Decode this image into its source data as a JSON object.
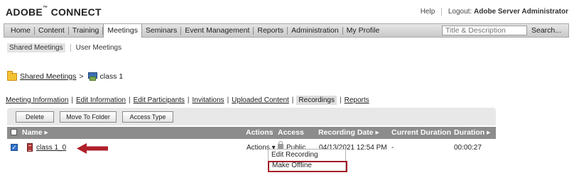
{
  "header": {
    "brand": "ADOBE",
    "brand_rest": " CONNECT",
    "tm": "™",
    "help": "Help",
    "logout": "Logout:",
    "user": "Adobe Server Administrator"
  },
  "nav": {
    "items": [
      "Home",
      "Content",
      "Training",
      "Meetings",
      "Seminars",
      "Event Management",
      "Reports",
      "Administration",
      "My Profile"
    ],
    "active_index": 3,
    "search_placeholder": "Title & Description",
    "search_button": "Search..."
  },
  "subnav": {
    "items": [
      "Shared Meetings",
      "User Meetings"
    ]
  },
  "breadcrumb": {
    "parent": "Shared Meetings",
    "separator": ">",
    "current": "class 1"
  },
  "tabs": {
    "items": [
      "Meeting Information",
      "Edit Information",
      "Edit Participants",
      "Invitations",
      "Uploaded Content",
      "Recordings",
      "Reports"
    ],
    "active_index": 5,
    "separator": "|"
  },
  "toolbar": {
    "delete": "Delete",
    "move": "Move To Folder",
    "access": "Access Type"
  },
  "table": {
    "columns": {
      "name": "Name ▸",
      "actions": "Actions",
      "access": "Access",
      "date": "Recording Date ▸",
      "current": "Current Duration",
      "duration": "Duration ▸"
    },
    "rows": [
      {
        "checked": true,
        "name": "class 1_0",
        "actions": "Actions ▾",
        "access": "Public",
        "date": "04/13/2021 12:54 PM",
        "current": "-",
        "duration": "00:00:27"
      }
    ]
  },
  "menu": {
    "items": [
      "Edit Recording",
      "Make Offline"
    ],
    "highlighted_index": 1
  },
  "colors": {
    "nav_bg": "#d6d6d6",
    "table_header": "#8c8c8c",
    "annotation_arrow": "#b0202a",
    "highlight_border": "#a11c25",
    "checkbox_blue": "#2f6fc8"
  },
  "icons": {
    "folder": "folder-icon",
    "meeting": "meeting-icon",
    "recording": "recording-icon",
    "lock": "lock-icon"
  }
}
